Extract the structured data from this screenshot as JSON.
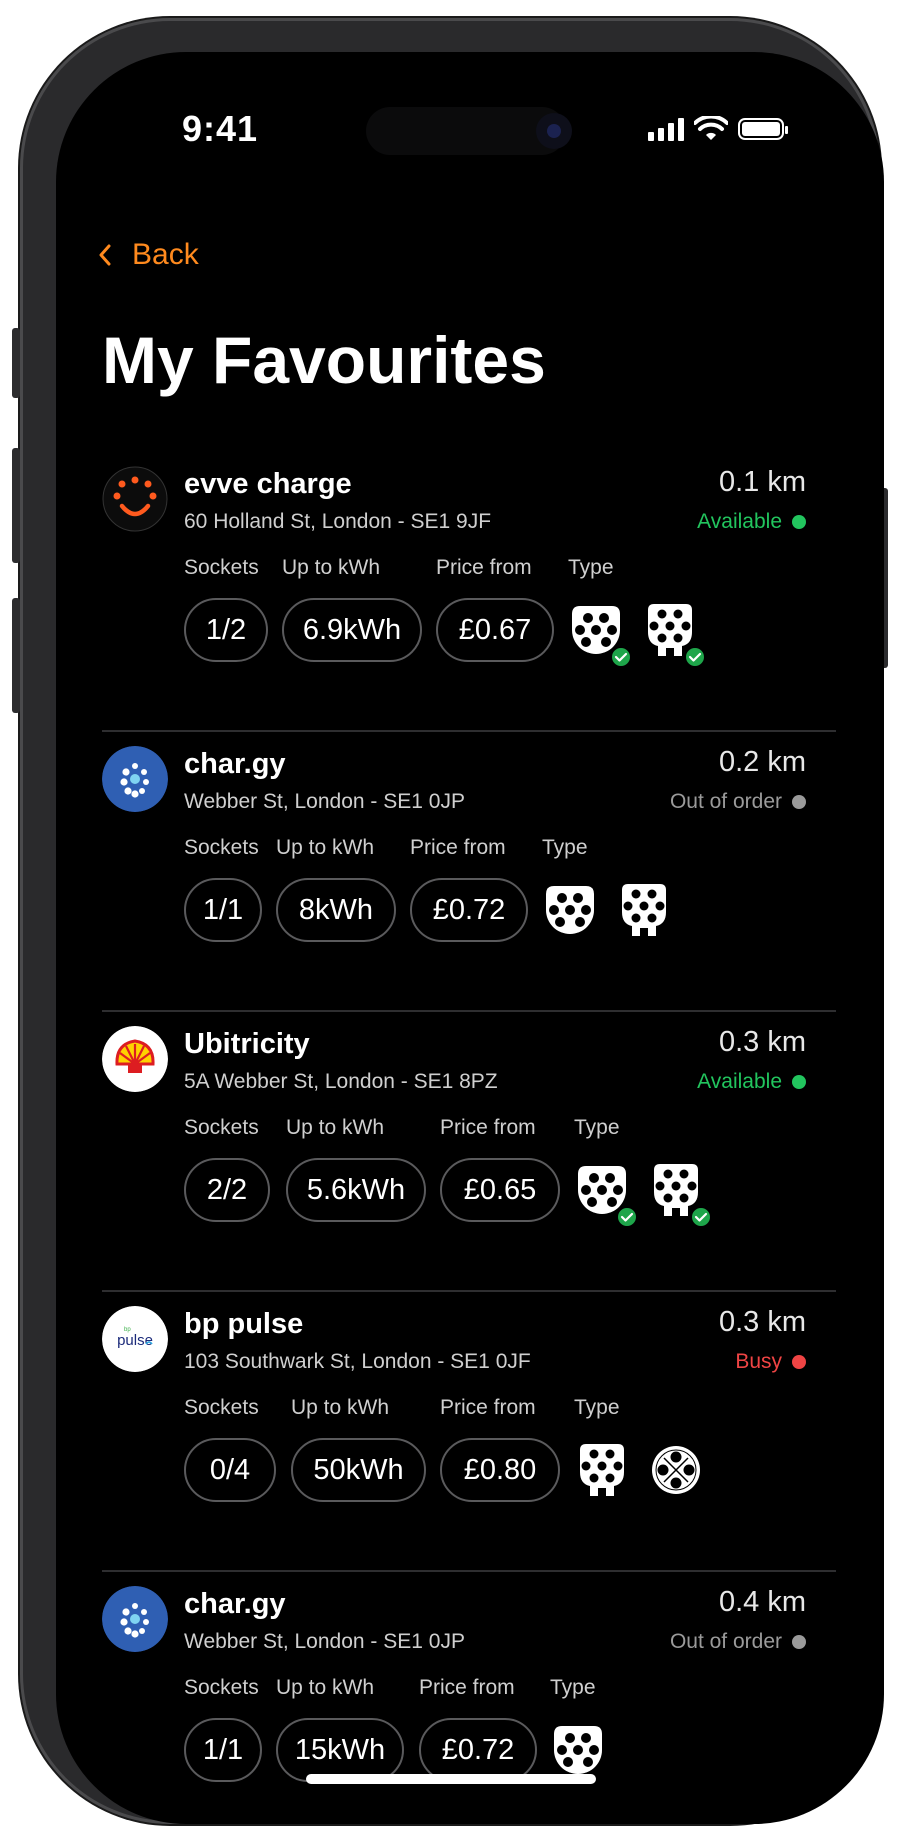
{
  "status_bar": {
    "time": "9:41"
  },
  "nav": {
    "back_label": "Back"
  },
  "page": {
    "title": "My Favourites"
  },
  "labels": {
    "sockets": "Sockets",
    "kwh": "Up to kWh",
    "price": "Price from",
    "type": "Type"
  },
  "colors": {
    "accent": "#ff8a1e",
    "available": "#22c55e",
    "out_of_order": "#9a9a9a",
    "busy": "#ef4444"
  },
  "stations": [
    {
      "name": "evve charge",
      "address": "60 Holland St, London - SE1 9JF",
      "distance": "0.1 km",
      "status": "Available",
      "status_color": "#22c55e",
      "sockets": "1/2",
      "kwh": "6.9kWh",
      "price": "£0.67",
      "logo": "evve-logo-icon",
      "types": [
        "ccs-connector-icon",
        "type2-connector-icon"
      ],
      "checked": true
    },
    {
      "name": "char.gy",
      "address": "Webber St, London - SE1 0JP",
      "distance": "0.2 km",
      "status": "Out of order",
      "status_color": "#9a9a9a",
      "sockets": "1/1",
      "kwh": "8kWh",
      "price": "£0.72",
      "logo": "chargy-logo-icon",
      "types": [
        "ccs-connector-icon",
        "type2-connector-icon"
      ],
      "checked": false
    },
    {
      "name": "Ubitricity",
      "address": "5A Webber St, London - SE1 8PZ",
      "distance": "0.3 km",
      "status": "Available",
      "status_color": "#22c55e",
      "sockets": "2/2",
      "kwh": "5.6kWh",
      "price": "£0.65",
      "logo": "shell-logo-icon",
      "types": [
        "ccs-connector-icon",
        "type2-connector-icon"
      ],
      "checked": true
    },
    {
      "name": "bp pulse",
      "address": "103 Southwark St, London - SE1 0JF",
      "distance": "0.3 km",
      "status": "Busy",
      "status_color": "#ef4444",
      "sockets": "0/4",
      "kwh": "50kWh",
      "price": "£0.80",
      "logo": "bp-pulse-logo-icon",
      "logo_text": "pulse",
      "types": [
        "type2-connector-icon",
        "chademo-connector-icon"
      ],
      "checked": false
    },
    {
      "name": "char.gy",
      "address": "Webber St, London - SE1 0JP",
      "distance": "0.4 km",
      "status": "Out of order",
      "status_color": "#9a9a9a",
      "sockets": "1/1",
      "kwh": "15kWh",
      "price": "£0.72",
      "logo": "chargy-logo-icon",
      "types": [
        "ccs-connector-icon"
      ],
      "checked": false
    }
  ]
}
